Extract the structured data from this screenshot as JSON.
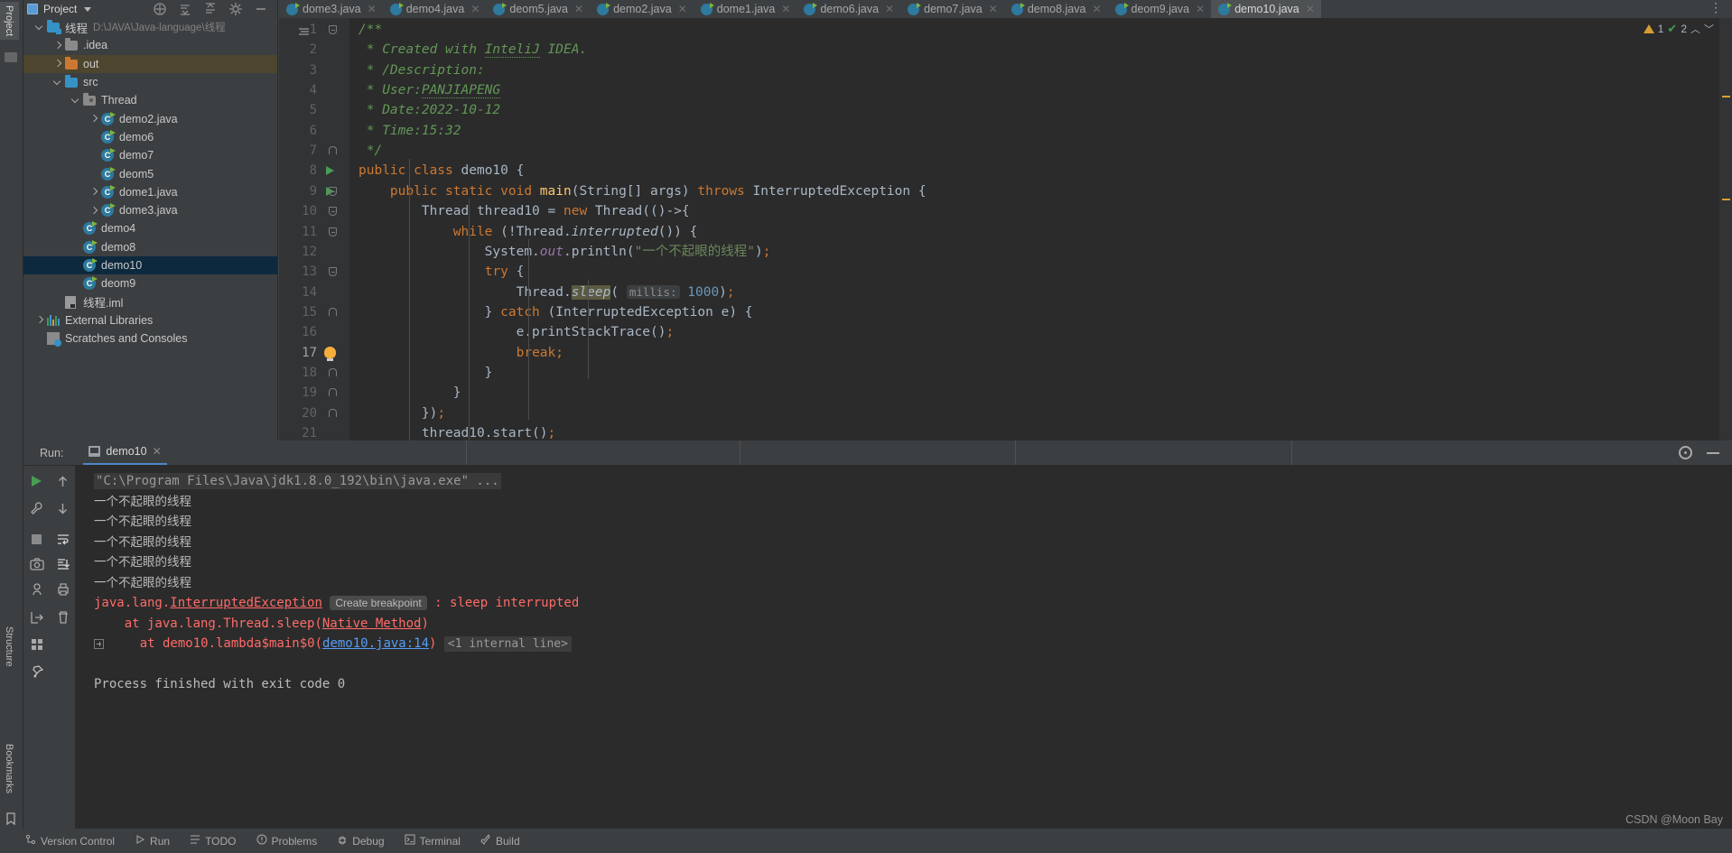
{
  "toolwindow_tabs": {
    "project": "Project",
    "structure": "Structure",
    "bookmarks": "Bookmarks"
  },
  "project_panel": {
    "title": "Project",
    "icons": [
      "collapse-icon",
      "expand-all-icon",
      "collapse-all-icon",
      "settings-icon",
      "hide-icon"
    ],
    "tree": [
      {
        "label": "线程",
        "path": "D:\\JAVA\\Java-language\\线程",
        "indent": 0,
        "arrow": "down",
        "icon": "module-folder-icon",
        "state": "normal"
      },
      {
        "label": ".idea",
        "path": "",
        "indent": 1,
        "arrow": "right",
        "icon": "folder-grey-icon",
        "state": "normal"
      },
      {
        "label": "out",
        "path": "",
        "indent": 1,
        "arrow": "right",
        "icon": "folder-orange-icon",
        "state": "highlight"
      },
      {
        "label": "src",
        "path": "",
        "indent": 1,
        "arrow": "down",
        "icon": "folder-blue-icon",
        "state": "normal"
      },
      {
        "label": "Thread",
        "path": "",
        "indent": 2,
        "arrow": "down",
        "icon": "package-icon",
        "state": "normal"
      },
      {
        "label": "demo2.java",
        "path": "",
        "indent": 3,
        "arrow": "right",
        "icon": "java-class-icon",
        "state": "normal"
      },
      {
        "label": "demo6",
        "path": "",
        "indent": 3,
        "arrow": "none",
        "icon": "java-class-icon",
        "state": "normal"
      },
      {
        "label": "demo7",
        "path": "",
        "indent": 3,
        "arrow": "none",
        "icon": "java-class-icon",
        "state": "normal"
      },
      {
        "label": "deom5",
        "path": "",
        "indent": 3,
        "arrow": "none",
        "icon": "java-class-icon",
        "state": "normal"
      },
      {
        "label": "dome1.java",
        "path": "",
        "indent": 3,
        "arrow": "right",
        "icon": "java-class-icon",
        "state": "normal"
      },
      {
        "label": "dome3.java",
        "path": "",
        "indent": 3,
        "arrow": "right",
        "icon": "java-class-icon",
        "state": "normal"
      },
      {
        "label": "demo4",
        "path": "",
        "indent": 2,
        "arrow": "none",
        "icon": "java-class-icon",
        "state": "normal"
      },
      {
        "label": "demo8",
        "path": "",
        "indent": 2,
        "arrow": "none",
        "icon": "java-class-icon",
        "state": "normal"
      },
      {
        "label": "demo10",
        "path": "",
        "indent": 2,
        "arrow": "none",
        "icon": "java-class-icon",
        "state": "selected"
      },
      {
        "label": "deom9",
        "path": "",
        "indent": 2,
        "arrow": "none",
        "icon": "java-class-icon",
        "state": "normal"
      },
      {
        "label": "线程.iml",
        "path": "",
        "indent": 1,
        "arrow": "none",
        "icon": "iml-file-icon",
        "state": "normal"
      },
      {
        "label": "External Libraries",
        "path": "",
        "indent": 0,
        "arrow": "right",
        "icon": "library-icon",
        "state": "normal"
      },
      {
        "label": "Scratches and Consoles",
        "path": "",
        "indent": 0,
        "arrow": "none",
        "icon": "scratches-icon",
        "state": "normal"
      }
    ]
  },
  "editor_tabs": {
    "items": [
      {
        "label": "dome3.java",
        "active": false
      },
      {
        "label": "demo4.java",
        "active": false
      },
      {
        "label": "deom5.java",
        "active": false
      },
      {
        "label": "demo2.java",
        "active": false
      },
      {
        "label": "dome1.java",
        "active": false
      },
      {
        "label": "demo6.java",
        "active": false
      },
      {
        "label": "demo7.java",
        "active": false
      },
      {
        "label": "demo8.java",
        "active": false
      },
      {
        "label": "deom9.java",
        "active": false
      },
      {
        "label": "demo10.java",
        "active": true
      }
    ],
    "more": "⋮"
  },
  "inspection_widget": {
    "warning_count": "1",
    "weak_warning_count": "2"
  },
  "code": {
    "lines": [
      {
        "n": "1",
        "text": "/**"
      },
      {
        "n": "2",
        "text": " * Created with InteliJ IDEA."
      },
      {
        "n": "3",
        "text": " * /Description:"
      },
      {
        "n": "4",
        "text": " * User:PANJIAPENG"
      },
      {
        "n": "5",
        "text": " * Date:2022-10-12"
      },
      {
        "n": "6",
        "text": " * Time:15:32"
      },
      {
        "n": "7",
        "text": " */"
      },
      {
        "n": "8",
        "text": "public class demo10 {"
      },
      {
        "n": "9",
        "text": "    public static void main(String[] args) throws InterruptedException {"
      },
      {
        "n": "10",
        "text": "        Thread thread10 = new Thread(()->{"
      },
      {
        "n": "11",
        "text": "            while (!Thread.interrupted()) {"
      },
      {
        "n": "12",
        "text": "                System.out.println(\"一个不起眼的线程\");"
      },
      {
        "n": "13",
        "text": "                try {"
      },
      {
        "n": "14",
        "text": "                    Thread.sleep( millis: 1000);"
      },
      {
        "n": "15",
        "text": "                } catch (InterruptedException e) {"
      },
      {
        "n": "16",
        "text": "                    e.printStackTrace();"
      },
      {
        "n": "17",
        "text": "                    break;"
      },
      {
        "n": "18",
        "text": "                }"
      },
      {
        "n": "19",
        "text": "            }"
      },
      {
        "n": "20",
        "text": "        });"
      },
      {
        "n": "21",
        "text": "        thread10.start();"
      }
    ],
    "hint_label": "millis:"
  },
  "run_panel": {
    "label": "Run:",
    "tab_name": "demo10",
    "tools": [
      "run-icon",
      "up-arrow-icon",
      "wrench-icon",
      "down-arrow-icon",
      "stop-icon",
      "soft-wrap-icon",
      "camera-icon",
      "scroll-to-end-icon",
      "trace-icon",
      "print-icon",
      "export-icon",
      "trash-icon"
    ],
    "header_right": [
      "settings-gear-icon",
      "hide-minus-icon"
    ],
    "console": {
      "command": "\"C:\\Program Files\\Java\\jdk1.8.0_192\\bin\\java.exe\" ...",
      "outputs": [
        "一个不起眼的线程",
        "一个不起眼的线程",
        "一个不起眼的线程",
        "一个不起眼的线程",
        "一个不起眼的线程"
      ],
      "exception_class": "java.lang.",
      "exception_name": "InterruptedException",
      "breakpoint_chip": "Create breakpoint",
      "exception_message": ": sleep interrupted",
      "stack_line_1_pre": "    at java.lang.Thread.sleep(",
      "stack_line_1_link": "Native Method",
      "stack_line_1_post": ")",
      "stack_line_2_pre": "    at demo10.lambda$main$0(",
      "stack_line_2_link": "demo10.java:14",
      "stack_line_2_post": ")",
      "internal_chip": "<1 internal line>",
      "exit_message": "Process finished with exit code 0"
    }
  },
  "statusbar": {
    "items": [
      {
        "label": "Version Control",
        "icon": "branch-icon"
      },
      {
        "label": "Run",
        "icon": "run-icon"
      },
      {
        "label": "TODO",
        "icon": "todo-icon"
      },
      {
        "label": "Problems",
        "icon": "problems-icon"
      },
      {
        "label": "Debug",
        "icon": "debug-icon"
      },
      {
        "label": "Terminal",
        "icon": "terminal-icon"
      },
      {
        "label": "Build",
        "icon": "build-icon"
      }
    ]
  },
  "watermark": "CSDN @Moon Bay",
  "colors": {
    "editor_bg": "#2b2b2b",
    "panel_bg": "#3c3f41",
    "selection": "#0d293e",
    "accent": "#4a88c7",
    "keyword": "#cc7832",
    "string": "#6a8759",
    "number": "#6897bb",
    "comment": "#629755",
    "error": "#ff6b68"
  }
}
